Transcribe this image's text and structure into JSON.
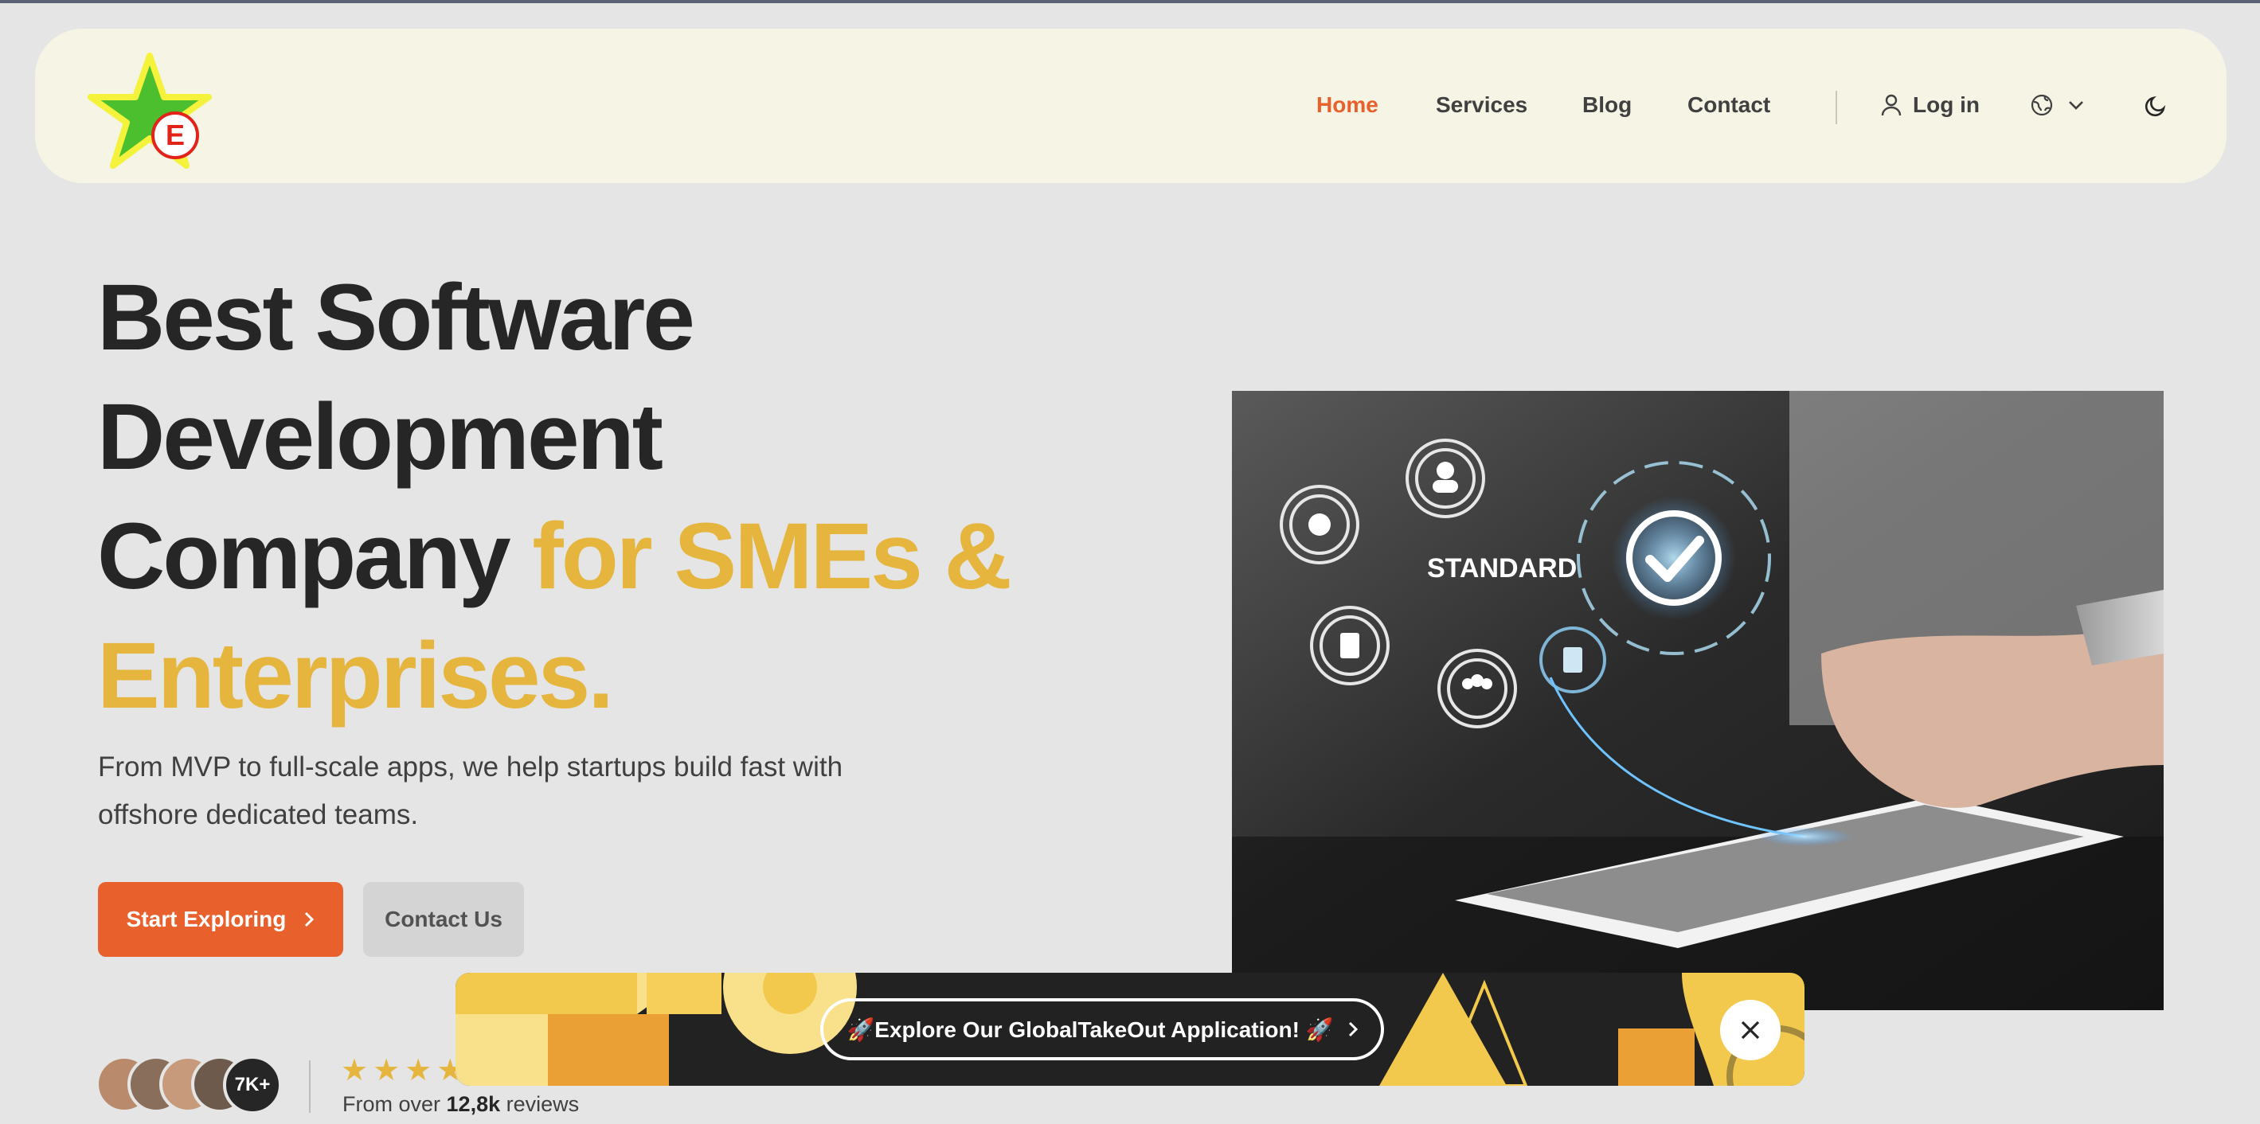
{
  "nav": {
    "items": [
      {
        "label": "Home",
        "active": true
      },
      {
        "label": "Services",
        "active": false
      },
      {
        "label": "Blog",
        "active": false
      },
      {
        "label": "Contact",
        "active": false
      }
    ],
    "login_label": "Log in",
    "language_icon": "globe-icon",
    "theme_icon": "moon-icon"
  },
  "hero": {
    "title_line1": "Best Software",
    "title_line2": "Development",
    "title_line3_plain": "Company ",
    "title_line3_accent": "for SMEs &",
    "title_line4_accent": "Enterprises.",
    "subtitle": "From MVP to full-scale apps, we help startups build fast with offshore dedicated teams.",
    "primary_button": "Start Exploring",
    "secondary_button": "Contact Us",
    "image_caption": "STANDARD"
  },
  "social_proof": {
    "avatar_count": "7K+",
    "rating": 5,
    "reviews_prefix": "From over ",
    "reviews_count": "12,8k",
    "reviews_suffix": " reviews"
  },
  "banner": {
    "label": "🚀Explore Our GlobalTakeOut Application! 🚀"
  },
  "colors": {
    "accent_orange": "#e8612c",
    "accent_yellow": "#e5b53d",
    "header_bg": "#f5f4e5",
    "page_bg": "#e5e5e5"
  }
}
